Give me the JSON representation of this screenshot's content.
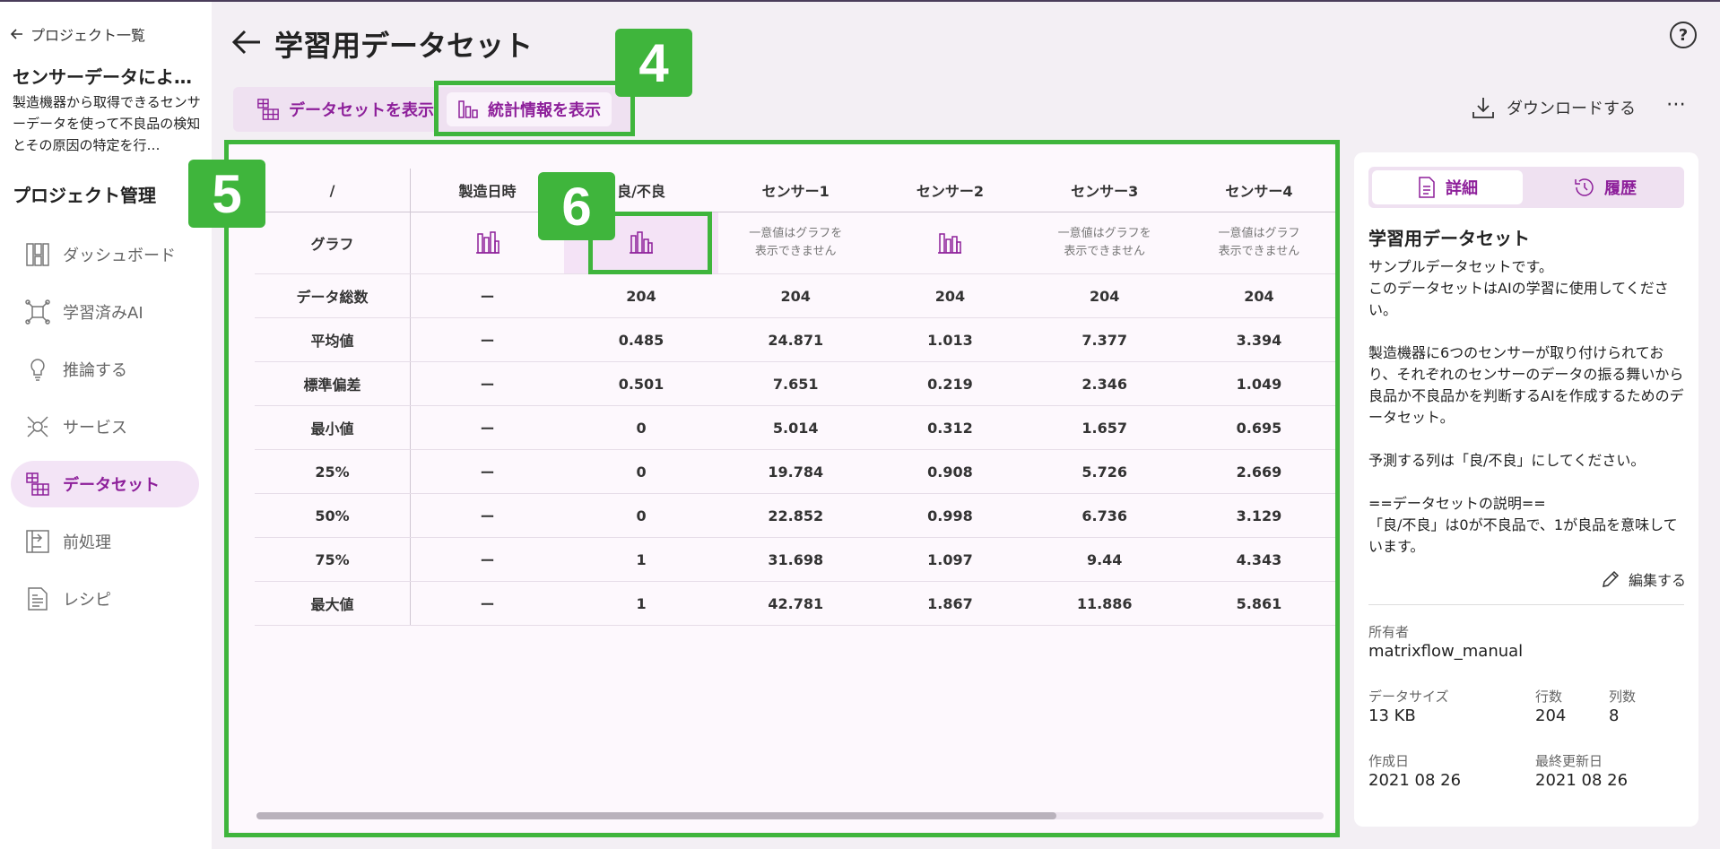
{
  "sidebar": {
    "back_label": "プロジェクト一覧",
    "project_title": "センサーデータによ…",
    "project_desc": "製造機器から取得できるセンサーデータを使って不良品の検知とその原因の特定を行…",
    "section_title": "プロジェクト管理",
    "items": [
      {
        "label": "ダッシュボード",
        "icon": "dashboard-icon"
      },
      {
        "label": "学習済みAI",
        "icon": "trained-ai-icon"
      },
      {
        "label": "推論する",
        "icon": "lightbulb-icon"
      },
      {
        "label": "サービス",
        "icon": "service-icon"
      },
      {
        "label": "データセット",
        "icon": "dataset-icon",
        "active": true
      },
      {
        "label": "前処理",
        "icon": "preprocess-icon"
      },
      {
        "label": "レシピ",
        "icon": "recipe-icon"
      }
    ]
  },
  "header": {
    "title": "学習用データセット",
    "tabs": [
      {
        "label": "データセットを表示"
      },
      {
        "label": "統計情報を表示"
      }
    ],
    "download_label": "ダウンロードする",
    "more_label": "⋯",
    "help_label": "?"
  },
  "table": {
    "corner": "/",
    "columns": [
      "製造日時",
      "良/不良",
      "センサー1",
      "センサー2",
      "センサー3",
      "センサー4"
    ],
    "graph_row_label": "グラフ",
    "no_graph_text_1": "一意値はグラフを",
    "no_graph_text_2": "表示できません",
    "no_graph_text_1b": "一意値はグラフ",
    "rows": [
      {
        "label": "データ総数",
        "values": [
          "ー",
          "204",
          "204",
          "204",
          "204",
          "204"
        ]
      },
      {
        "label": "平均値",
        "values": [
          "ー",
          "0.485",
          "24.871",
          "1.013",
          "7.377",
          "3.394"
        ]
      },
      {
        "label": "標準偏差",
        "values": [
          "ー",
          "0.501",
          "7.651",
          "0.219",
          "2.346",
          "1.049"
        ]
      },
      {
        "label": "最小値",
        "values": [
          "ー",
          "0",
          "5.014",
          "0.312",
          "1.657",
          "0.695"
        ]
      },
      {
        "label": "25%",
        "values": [
          "ー",
          "0",
          "19.784",
          "0.908",
          "5.726",
          "2.669"
        ]
      },
      {
        "label": "50%",
        "values": [
          "ー",
          "0",
          "22.852",
          "0.998",
          "6.736",
          "3.129"
        ]
      },
      {
        "label": "75%",
        "values": [
          "ー",
          "1",
          "31.698",
          "1.097",
          "9.44",
          "4.343"
        ]
      },
      {
        "label": "最大値",
        "values": [
          "ー",
          "1",
          "42.781",
          "1.867",
          "11.886",
          "5.861"
        ]
      }
    ]
  },
  "panel": {
    "tab_details": "詳細",
    "tab_history": "履歴",
    "title": "学習用データセット",
    "description": "サンプルデータセットです。\nこのデータセットはAIの学習に使用してください。\n\n製造機器に6つのセンサーが取り付けられており、それぞれのセンサーのデータの振る舞いから良品か不良品かを判断するAIを作成するためのデータセット。\n\n予測する列は「良/不良」にしてください。\n\n==データセットの説明==\n「良/不良」は0が不良品で、1が良品を意味しています。",
    "edit_label": "編集する",
    "owner_label": "所有者",
    "owner": "matrixflow_manual",
    "size_label": "データサイズ",
    "size": "13 KB",
    "rows_label": "行数",
    "rows": "204",
    "cols_label": "列数",
    "cols": "8",
    "created_label": "作成日",
    "created": "2021 08 26",
    "updated_label": "最終更新日",
    "updated": "2021 08 26"
  },
  "annotations": {
    "badge_4": "4",
    "badge_5": "5",
    "badge_6": "6"
  },
  "colors": {
    "accent": "#8d1f9a",
    "annotation": "#3fb53c"
  }
}
